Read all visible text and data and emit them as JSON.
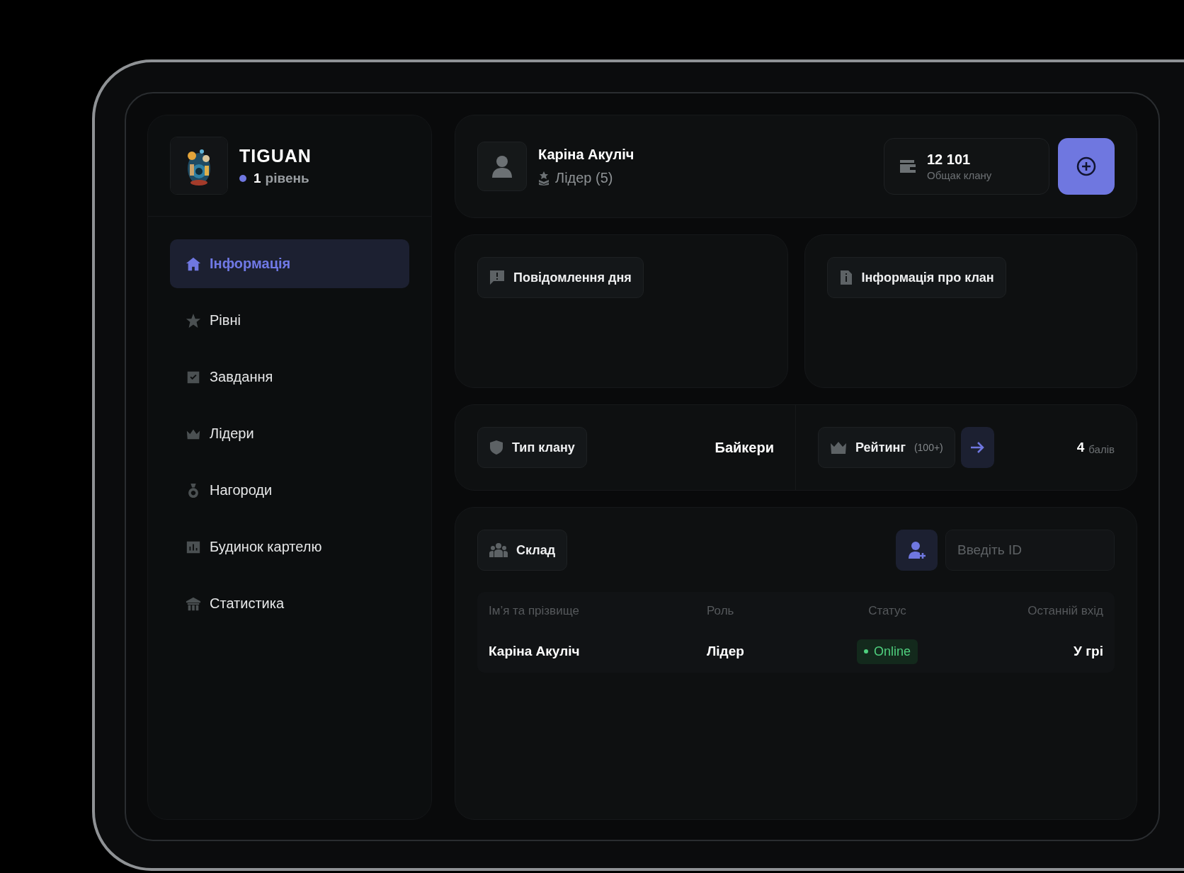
{
  "clan": {
    "name": "TIGUAN",
    "level_number": "1",
    "level_label": "рівень"
  },
  "nav": [
    {
      "label": "Інформація",
      "selected": true
    },
    {
      "label": "Рівні",
      "selected": false
    },
    {
      "label": "Завдання",
      "selected": false
    },
    {
      "label": "Лідери",
      "selected": false
    },
    {
      "label": "Нагороди",
      "selected": false
    },
    {
      "label": "Будинок картелю",
      "selected": false
    },
    {
      "label": "Статистика",
      "selected": false
    }
  ],
  "profile": {
    "name": "Каріна Акуліч",
    "role": "Лідер (5)"
  },
  "treasury": {
    "amount": "12 101",
    "label": "Общак клану"
  },
  "panels": [
    {
      "title": "Повідомлення дня"
    },
    {
      "title": "Інформація про клан"
    }
  ],
  "clan_type": {
    "label": "Тип клану",
    "value": "Байкери"
  },
  "rating": {
    "label": "Рейтинг",
    "hint": "(100+)",
    "points": "4",
    "unit": "балів"
  },
  "roster": {
    "title": "Склад",
    "search": {
      "placeholder": "Введіть ID"
    },
    "columns": [
      "Ім’я та прізвище",
      "Роль",
      "Статус",
      "Останній вхід"
    ],
    "rows": [
      {
        "name": "Каріна Акуліч",
        "role": "Лідер",
        "status": "Online",
        "online": true,
        "last_login": "У грі"
      }
    ]
  }
}
